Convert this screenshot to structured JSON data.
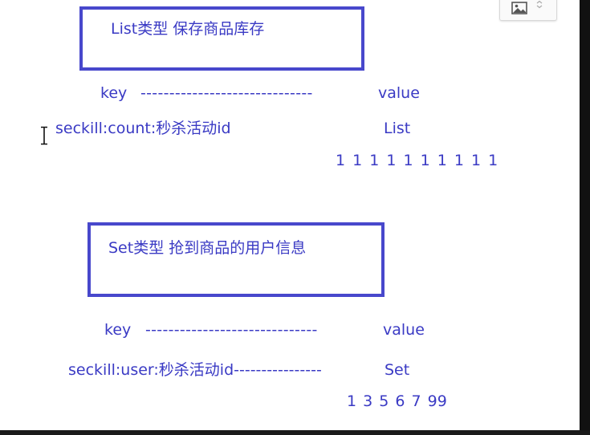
{
  "list_section": {
    "title": "List类型 保存商品库存",
    "key_label": "key",
    "separator": "------------------------------",
    "value_label": "value",
    "entry_key": "seckill:count:秒杀活动id",
    "entry_type": "List",
    "entry_values": "1 1 1 1 1 1 1 1 1 1"
  },
  "set_section": {
    "title": "Set类型 抢到商品的用户信息",
    "key_label": "key",
    "separator": "------------------------------",
    "value_label": "value",
    "entry_key": "seckill:user:秒杀活动id----------------",
    "entry_type": "Set",
    "entry_values": "1 3 5 6 7 99"
  },
  "icons": {
    "toolbar": [
      "image-icon",
      "chevron-down-icon"
    ],
    "pointer": "text-cursor-icon"
  },
  "colors": {
    "text": "#3a3ac4",
    "box_border": "#4848cc",
    "background": "#ffffff"
  }
}
